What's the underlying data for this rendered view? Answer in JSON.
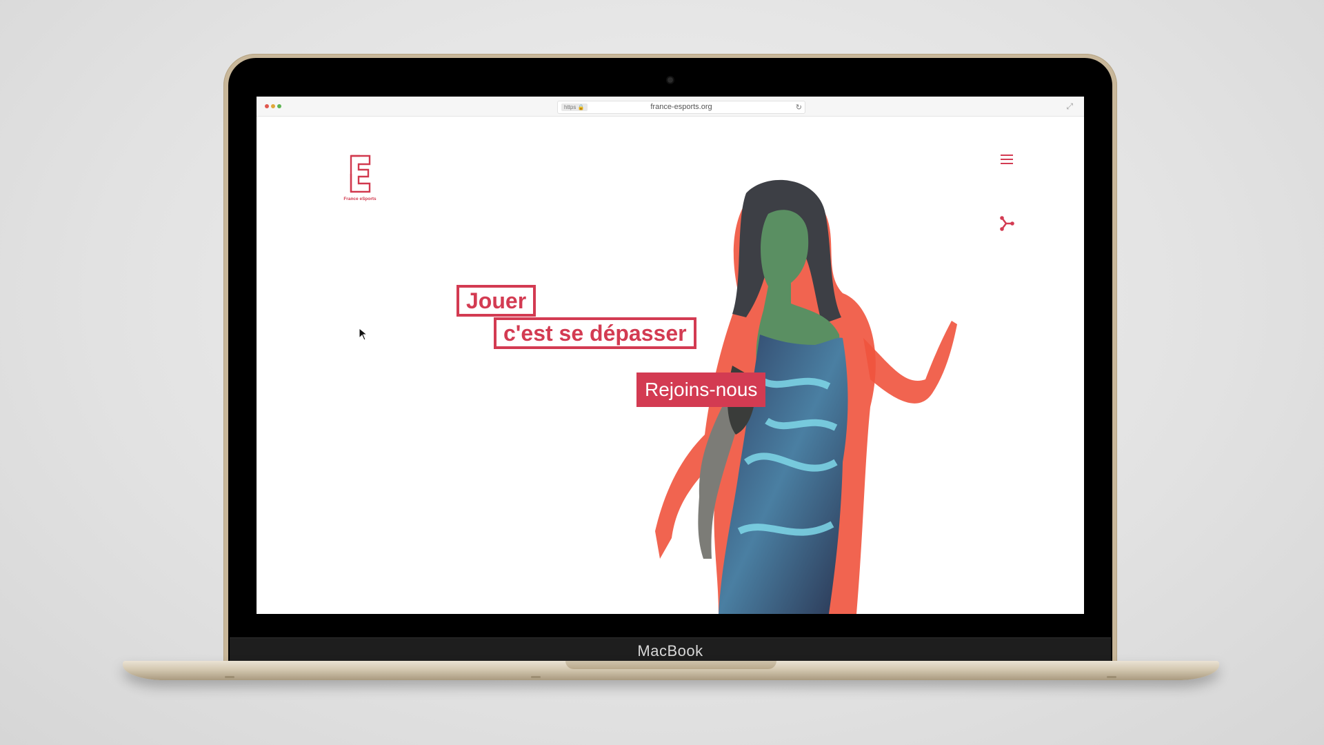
{
  "device": {
    "brand_label": "MacBook"
  },
  "browser": {
    "protocol_badge": "https 🔒",
    "url": "france-esports.org",
    "reload_icon": "reload-icon",
    "expand_icon": "expand-icon",
    "traffic_lights": [
      "#e0584f",
      "#e0a83a",
      "#5eb454"
    ]
  },
  "site": {
    "logo_text": "France eSports",
    "headline_line1": "Jouer",
    "headline_line2": "c'est se dépasser",
    "cta_label": "Rejoins-nous",
    "menu_icon": "hamburger-menu-icon",
    "share_icon": "share-icon",
    "accent_color": "#d33b52"
  }
}
